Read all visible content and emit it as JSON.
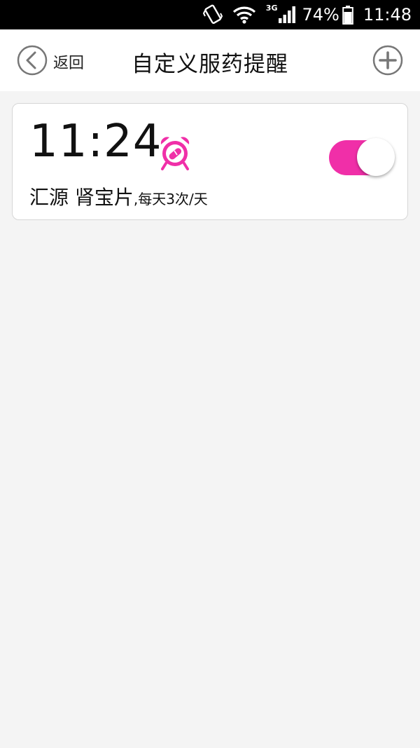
{
  "status_bar": {
    "network_label": "3G",
    "battery_percent": "74%",
    "time": "11:48"
  },
  "header": {
    "back_label": "返回",
    "title": "自定义服药提醒",
    "icons": {
      "back": "chevron-left-circle-icon",
      "add": "plus-circle-icon"
    }
  },
  "reminders": [
    {
      "time": "11:24",
      "icon": "alarm-clock-pill-icon",
      "medicine": "汇源 肾宝片",
      "frequency": ",每天3次/天",
      "enabled": true
    }
  ],
  "colors": {
    "accent": "#f02fa8",
    "background": "#f4f4f4",
    "header_bg": "#ffffff",
    "status_bar_bg": "#000000"
  }
}
